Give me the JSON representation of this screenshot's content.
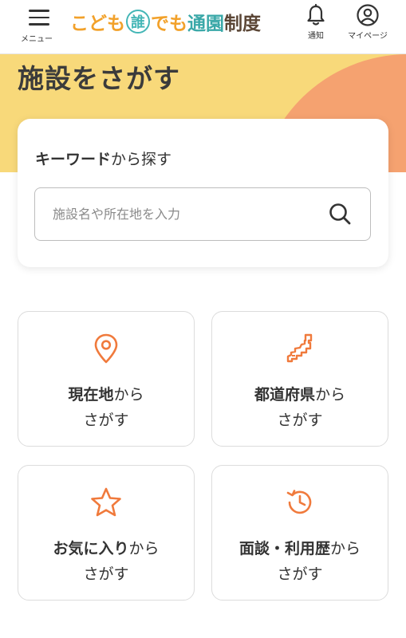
{
  "header": {
    "menu_label": "メニュー",
    "logo": {
      "part1": "こども",
      "part2": "誰",
      "part3": "でも",
      "part4": "通園",
      "part5": "制度"
    },
    "notify_label": "通知",
    "mypage_label": "マイページ"
  },
  "hero": {
    "title": "施設をさがす"
  },
  "search": {
    "heading_bold": "キーワード",
    "heading_rest": "から探す",
    "placeholder": "施設名や所在地を入力",
    "value": ""
  },
  "tiles": [
    {
      "icon": "location-pin-icon",
      "bold": "現在地",
      "rest": "から",
      "line2": "さがす"
    },
    {
      "icon": "japan-map-icon",
      "bold": "都道府県",
      "rest": "から",
      "line2": "さがす"
    },
    {
      "icon": "star-icon",
      "bold": "お気に入り",
      "rest": "から",
      "line2": "さがす"
    },
    {
      "icon": "history-icon",
      "bold": "面談・利用歴",
      "rest": "から",
      "line2": "さがす"
    }
  ],
  "colors": {
    "accent_orange": "#f07a3c",
    "hero_yellow": "#f8d97a",
    "hero_peach": "#f5a270",
    "logo_orange": "#f2a12a",
    "logo_teal": "#3aa8a8",
    "logo_brown": "#5b4636"
  }
}
